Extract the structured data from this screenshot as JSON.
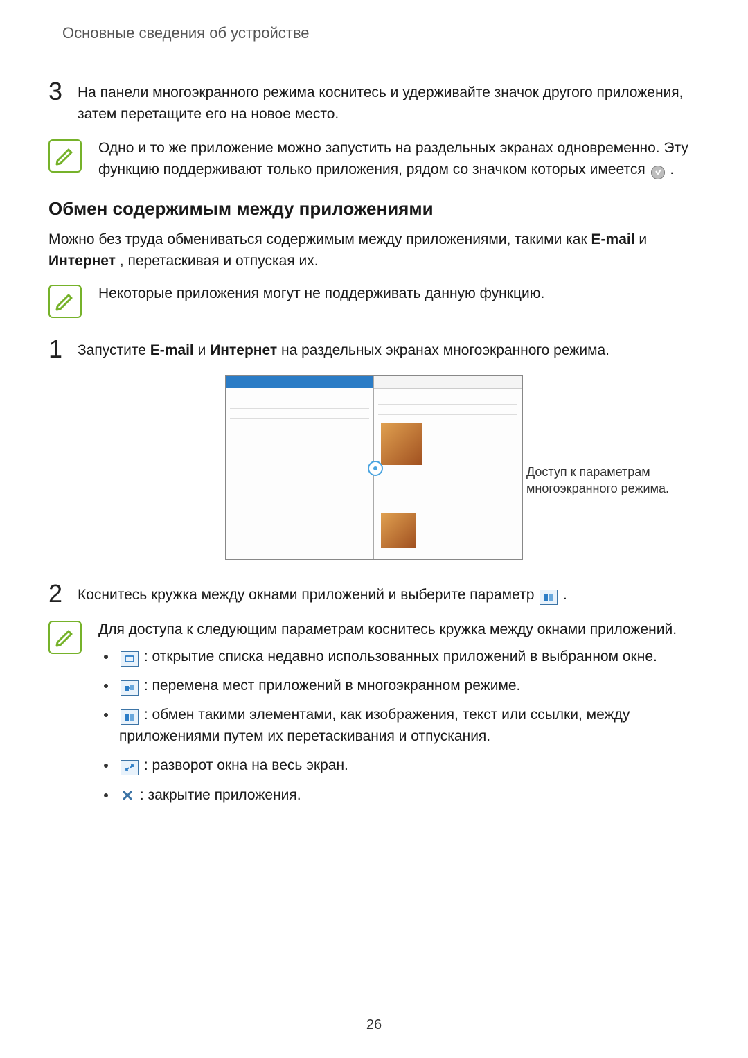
{
  "header": {
    "title": "Основные сведения об устройстве"
  },
  "step3": {
    "number": "3",
    "text": "На панели многоэкранного режима коснитесь и удерживайте значок другого приложения, затем перетащите его на новое место."
  },
  "note1": {
    "text_a": "Одно и то же приложение можно запустить на раздельных экранах одновременно. Эту функцию поддерживают только приложения, рядом со значком которых имеется ",
    "text_b": "."
  },
  "section": {
    "heading": "Обмен содержимым между приложениями"
  },
  "intro": {
    "a": "Можно без труда обмениваться содержимым между приложениями, такими как ",
    "b": "E-mail",
    "c": " и ",
    "d": "Интернет",
    "e": ", перетаскивая и отпуская их."
  },
  "note2": {
    "text": "Некоторые приложения могут не поддерживать данную функцию."
  },
  "step1": {
    "number": "1",
    "a": "Запустите ",
    "b": "E-mail",
    "c": " и ",
    "d": "Интернет",
    "e": " на раздельных экранах многоэкранного режима."
  },
  "figure": {
    "callout": "Доступ к параметрам многоэкранного режима."
  },
  "step2": {
    "number": "2",
    "a": "Коснитесь кружка между окнами приложений и выберите параметр ",
    "b": "."
  },
  "note3": {
    "lead": "Для доступа к следующим параметрам коснитесь кружка между окнами приложений.",
    "items": {
      "recent": ": открытие списка недавно использованных приложений в выбранном окне.",
      "swap": ": перемена мест приложений в многоэкранном режиме.",
      "share": ": обмен такими элементами, как изображения, текст или ссылки, между приложениями путем их перетаскивания и отпускания.",
      "expand": ": разворот окна на весь экран.",
      "close": ": закрытие приложения."
    }
  },
  "page_number": "26"
}
